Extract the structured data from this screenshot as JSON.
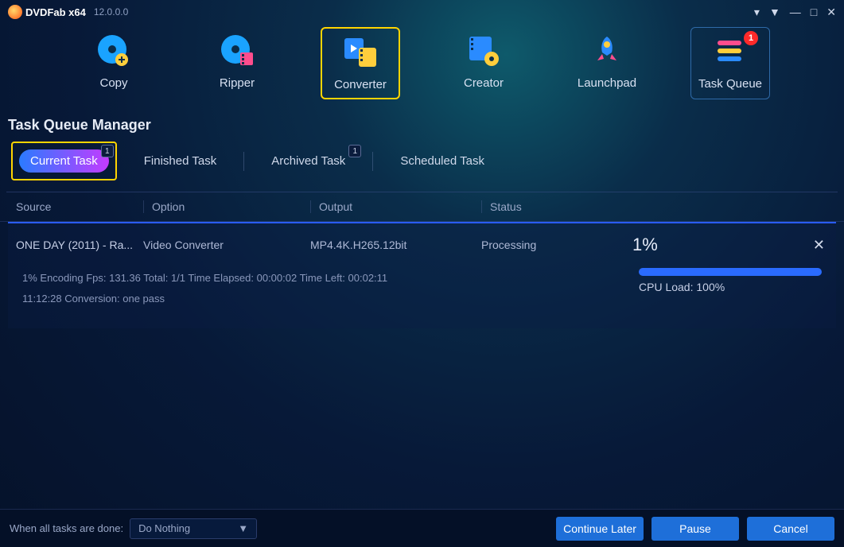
{
  "title": {
    "app": "DVDFab x64",
    "version": "12.0.0.0"
  },
  "nav": {
    "items": [
      {
        "label": "Copy"
      },
      {
        "label": "Ripper"
      },
      {
        "label": "Converter"
      },
      {
        "label": "Creator"
      },
      {
        "label": "Launchpad"
      },
      {
        "label": "Task Queue",
        "badge": "1"
      }
    ]
  },
  "section": {
    "title": "Task Queue Manager"
  },
  "tabs": {
    "current": {
      "label": "Current Task",
      "badge": "1"
    },
    "finished": {
      "label": "Finished Task"
    },
    "archived": {
      "label": "Archived Task",
      "badge": "1"
    },
    "scheduled": {
      "label": "Scheduled Task"
    }
  },
  "columns": {
    "source": "Source",
    "option": "Option",
    "output": "Output",
    "status": "Status"
  },
  "task": {
    "source": "ONE DAY (2011) - Ra...",
    "option": "Video Converter",
    "output": "MP4.4K.H265.12bit",
    "status": "Processing",
    "progress_label": "1%",
    "detail_line1": "1%  Encoding Fps: 131.36  Total: 1/1  Time Elapsed: 00:00:02  Time Left: 00:02:11",
    "detail_line2": "11:12:28  Conversion: one pass",
    "cpu_load": "CPU Load: 100%",
    "progress_pct": 100
  },
  "footer": {
    "when_done_label": "When all tasks are done:",
    "when_done_value": "Do Nothing",
    "continue": "Continue Later",
    "pause": "Pause",
    "cancel": "Cancel"
  }
}
